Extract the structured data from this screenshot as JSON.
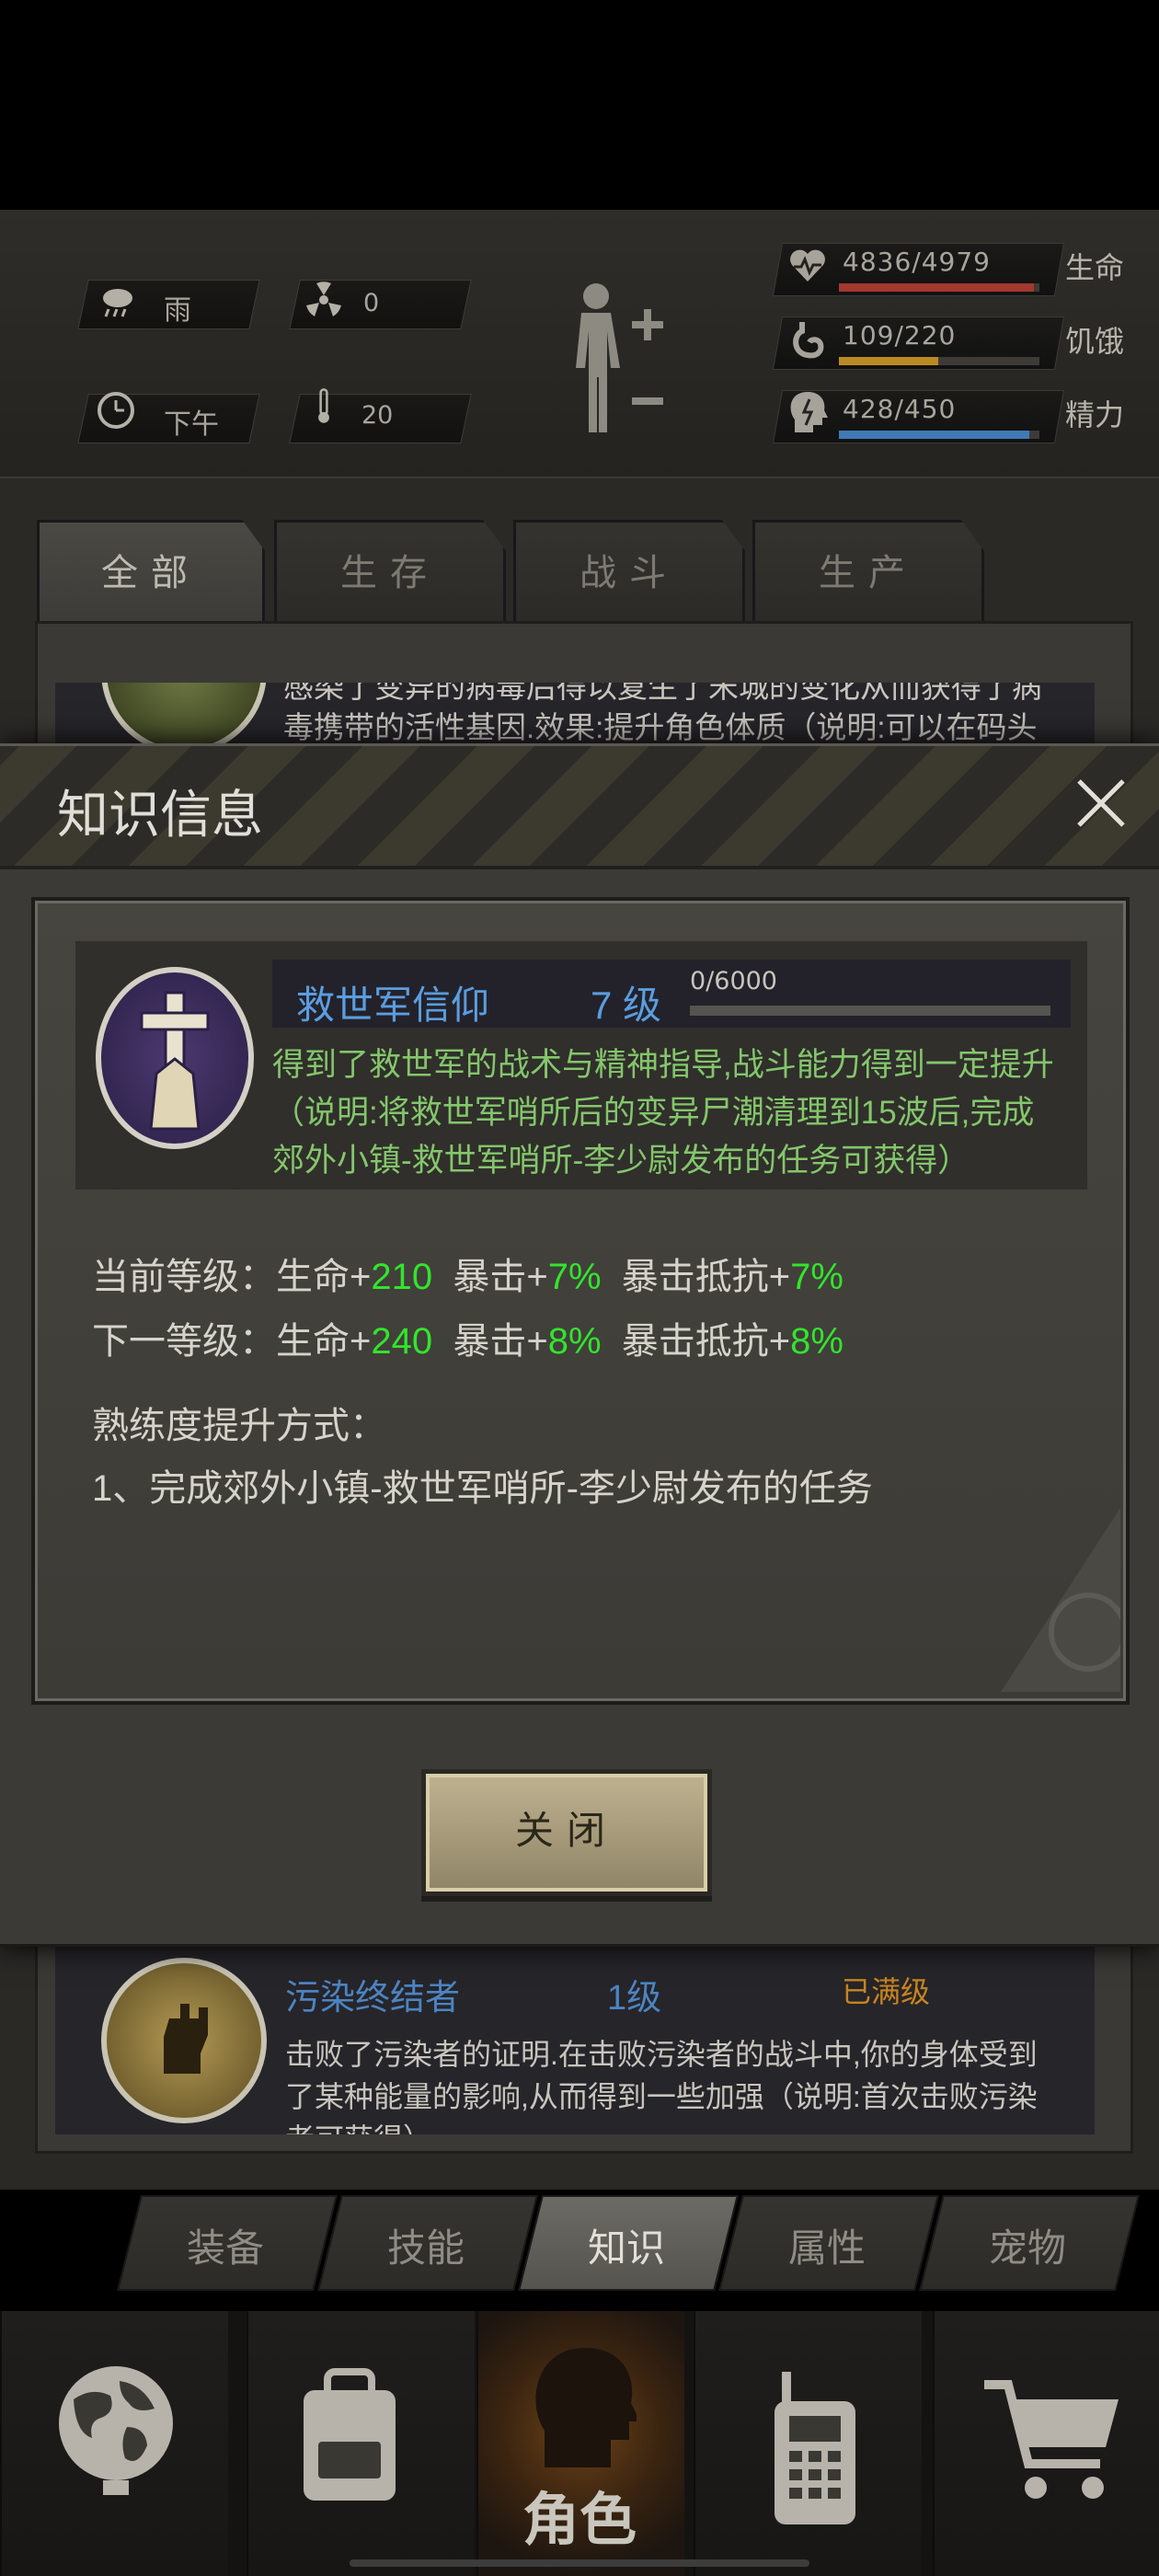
{
  "status": {
    "weather": "雨",
    "radiation": "0",
    "time_of_day": "下午",
    "temperature": "20",
    "vitals": [
      {
        "icon": "heart-icon",
        "value": "4836/4979",
        "label": "生命",
        "fraction": 0.971,
        "color": "#a2382e"
      },
      {
        "icon": "stomach-icon",
        "value": "109/220",
        "label": "饥饿",
        "fraction": 0.495,
        "color": "#b98a24"
      },
      {
        "icon": "head-bolt-icon",
        "value": "428/450",
        "label": "精力",
        "fraction": 0.951,
        "color": "#3f7ab6"
      }
    ]
  },
  "category_tabs": [
    {
      "label": "全部",
      "active": true
    },
    {
      "label": "生存",
      "active": false
    },
    {
      "label": "战斗",
      "active": false
    },
    {
      "label": "生产",
      "active": false
    }
  ],
  "background_item_top": {
    "desc_line_1": "感染了变异的病毒后得以复生了宋城的变化从而获得了病",
    "desc_line_2": "毒携带的活性基因.效果:提升角色体质（说明:可以在码头"
  },
  "background_item_bottom": {
    "name": "污染终结者",
    "level": "1级",
    "status": "已满级",
    "desc_line_1": "击败了污染者的证明.在击败污染者的战斗中,你的身体受到",
    "desc_line_2": "了某种能量的影响,从而得到一些加强（说明:首次击败污染",
    "desc_line_3": "者可获得）"
  },
  "modal": {
    "title": "知识信息",
    "skill": {
      "name": "救世军信仰",
      "level": "7 级",
      "xp_text": "0/6000",
      "xp_fraction": 0,
      "desc": [
        "得到了救世军的战术与精神指导,战斗能力得到一定提升",
        "（说明:将救世军哨所后的变异尸潮清理到15波后,完成",
        "郊外小镇-救世军哨所-李少尉发布的任务可获得）"
      ]
    },
    "current_level": {
      "prefix": "当前等级：",
      "life_label": "生命+",
      "life_value": "210",
      "crit_label": "暴击+",
      "crit_value": "7%",
      "crit_res_label": "暴击抵抗+",
      "crit_res_value": "7%"
    },
    "next_level": {
      "prefix": "下一等级：",
      "life_label": "生命+",
      "life_value": "240",
      "crit_label": "暴击+",
      "crit_value": "8%",
      "crit_res_label": "暴击抵抗+",
      "crit_res_value": "8%"
    },
    "method_title": "熟练度提升方式：",
    "method_1": "1、完成郊外小镇-救世军哨所-李少尉发布的任务",
    "close_label": "关闭"
  },
  "sub_tabs": [
    {
      "label": "装备",
      "active": false
    },
    {
      "label": "技能",
      "active": false
    },
    {
      "label": "知识",
      "active": true
    },
    {
      "label": "属性",
      "active": false
    },
    {
      "label": "宠物",
      "active": false
    }
  ],
  "bottom_nav": {
    "role_label": "角色",
    "items": [
      "globe-icon",
      "backpack-icon",
      "role-head-icon",
      "walkie-talkie-icon",
      "cart-icon"
    ]
  }
}
